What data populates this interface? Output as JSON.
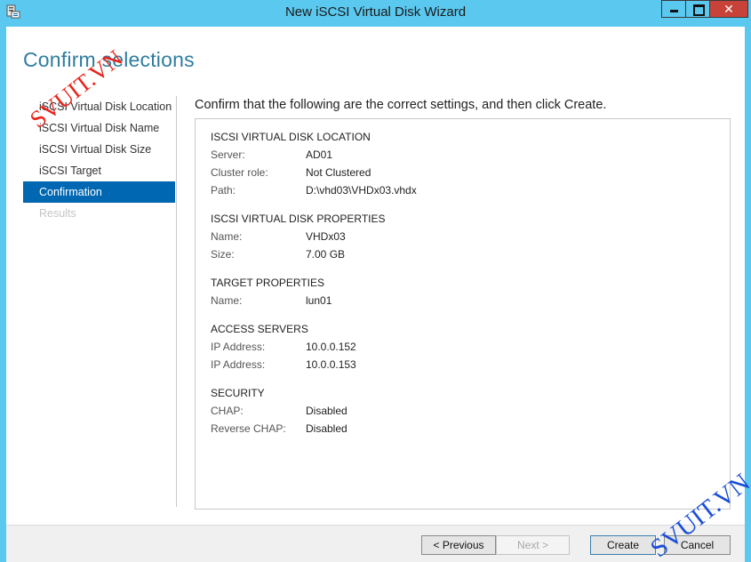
{
  "window": {
    "title": "New iSCSI Virtual Disk Wizard",
    "controls": {
      "minimize": "",
      "maximize": "",
      "close": "✕"
    }
  },
  "page": {
    "title": "Confirm selections",
    "instruction": "Confirm that the following are the correct settings, and then click Create."
  },
  "nav": {
    "items": [
      {
        "label": "iSCSI Virtual Disk Location",
        "state": "normal"
      },
      {
        "label": "iSCSI Virtual Disk Name",
        "state": "normal"
      },
      {
        "label": "iSCSI Virtual Disk Size",
        "state": "normal"
      },
      {
        "label": "iSCSI Target",
        "state": "normal"
      },
      {
        "label": "Confirmation",
        "state": "active"
      },
      {
        "label": "Results",
        "state": "disabled"
      }
    ]
  },
  "summary": {
    "sections": [
      {
        "title": "ISCSI VIRTUAL DISK LOCATION",
        "rows": [
          {
            "key": "Server:",
            "value": "AD01"
          },
          {
            "key": "Cluster role:",
            "value": "Not Clustered"
          },
          {
            "key": "Path:",
            "value": "D:\\vhd03\\VHDx03.vhdx"
          }
        ]
      },
      {
        "title": "ISCSI VIRTUAL DISK PROPERTIES",
        "rows": [
          {
            "key": "Name:",
            "value": "VHDx03"
          },
          {
            "key": "Size:",
            "value": "7.00 GB"
          }
        ]
      },
      {
        "title": "TARGET PROPERTIES",
        "rows": [
          {
            "key": "Name:",
            "value": "lun01"
          }
        ]
      },
      {
        "title": "ACCESS SERVERS",
        "rows": [
          {
            "key": "IP Address:",
            "value": "10.0.0.152"
          },
          {
            "key": "IP Address:",
            "value": "10.0.0.153"
          }
        ]
      },
      {
        "title": "SECURITY",
        "rows": [
          {
            "key": "CHAP:",
            "value": "Disabled"
          },
          {
            "key": "Reverse CHAP:",
            "value": "Disabled"
          }
        ]
      }
    ]
  },
  "footer": {
    "previous": "< Previous",
    "next": "Next >",
    "create": "Create",
    "cancel": "Cancel",
    "next_enabled": false
  },
  "watermarks": [
    "SVUIT.VN",
    "SVUIT.VN"
  ],
  "colors": {
    "chrome": "#5ac8ef",
    "title_accent": "#2f7d9f",
    "nav_active": "#0067b2",
    "close_button": "#c7433a",
    "watermark_red": "#e8231c",
    "watermark_blue": "#1b4fd6"
  }
}
